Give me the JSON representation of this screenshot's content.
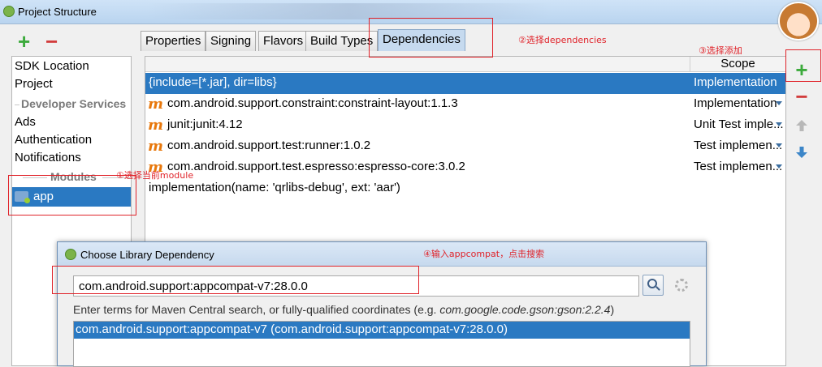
{
  "window": {
    "title": "Project Structure"
  },
  "left_toolbar": {
    "add": "+",
    "remove": "−"
  },
  "sidebar": {
    "items": [
      "SDK Location",
      "Project"
    ],
    "section_developer": "Developer Services",
    "dev_items": [
      "Ads",
      "Authentication",
      "Notifications"
    ],
    "section_modules": "Modules",
    "module": "app"
  },
  "tabs": [
    "Properties",
    "Signing",
    "Flavors",
    "Build Types",
    "Dependencies"
  ],
  "table": {
    "scope_header": "Scope",
    "rows": [
      {
        "name": "{include=[*.jar], dir=libs}",
        "scope": "Implementation"
      },
      {
        "name": "com.android.support.constraint:constraint-layout:1.1.3",
        "scope": "Implementation"
      },
      {
        "name": "junit:junit:4.12",
        "scope": "Unit Test imple..."
      },
      {
        "name": "com.android.support.test:runner:1.0.2",
        "scope": "Test implemen..."
      },
      {
        "name": "com.android.support.test.espresso:espresso-core:3.0.2",
        "scope": "Test implemen..."
      },
      {
        "name": "implementation(name: 'qrlibs-debug', ext: 'aar')",
        "scope": ""
      }
    ],
    "m_icon": "m"
  },
  "right_toolbar": {
    "add": "+",
    "remove": "−"
  },
  "annotations": {
    "a1": "①选择当前module",
    "a2": "②选择dependencies",
    "a3": "③选择添加",
    "a4": "④输入appcompat，点击搜索"
  },
  "dialog": {
    "title": "Choose Library Dependency",
    "input_value": "com.android.support:appcompat-v7:28.0.0",
    "hint_prefix": "Enter terms for Maven Central search, or fully-qualified coordinates (e.g. ",
    "hint_example": "com.google.code.gson:gson:2.2.4",
    "hint_suffix": ")",
    "result": "com.android.support:appcompat-v7 (com.android.support:appcompat-v7:28.0.0)"
  },
  "colors": {
    "selection": "#2a79c2",
    "annotation": "#e0232a",
    "add": "#3caa3c",
    "remove": "#d23c3c"
  }
}
